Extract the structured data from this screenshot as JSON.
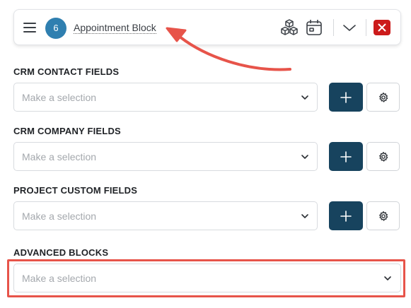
{
  "header": {
    "badge_count": "6",
    "title": "Appointment Block",
    "icons": [
      "menu-icon",
      "cubes-icon",
      "calendar-icon",
      "chevron-down-icon",
      "close-icon"
    ]
  },
  "sections": [
    {
      "label": "CRM CONTACT FIELDS",
      "placeholder": "Make a selection"
    },
    {
      "label": "CRM COMPANY FIELDS",
      "placeholder": "Make a selection"
    },
    {
      "label": "PROJECT CUSTOM FIELDS",
      "placeholder": "Make a selection"
    }
  ],
  "advanced": {
    "label": "ADVANCED BLOCKS",
    "placeholder": "Make a selection"
  },
  "colors": {
    "badge": "#2f7fb0",
    "add_button": "#17435e",
    "close_button": "#cc1b1b",
    "annotation": "#e7544a"
  }
}
